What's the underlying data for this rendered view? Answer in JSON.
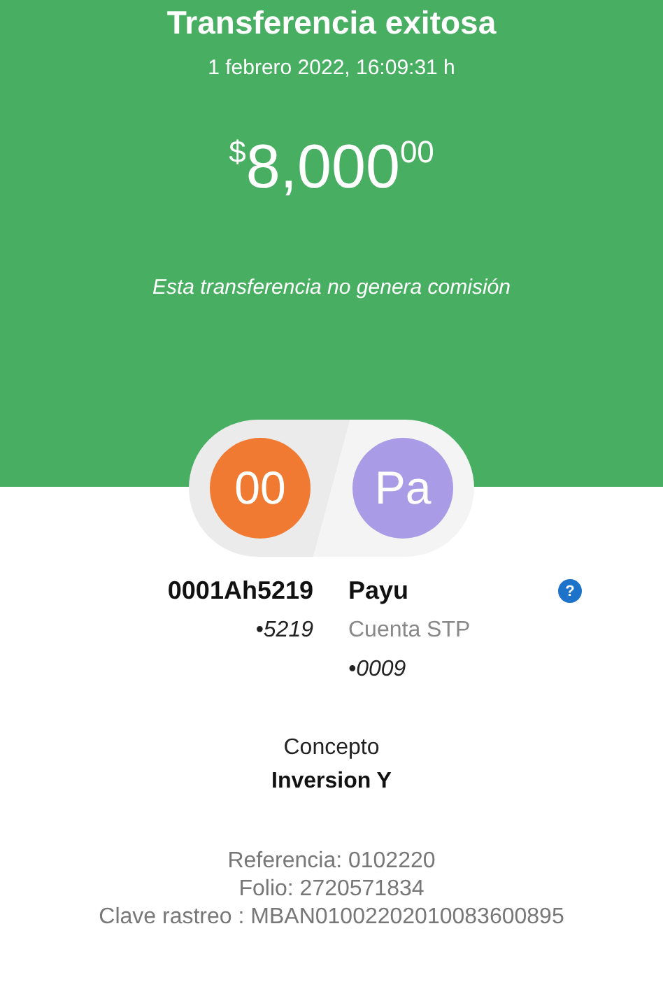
{
  "header": {
    "title": "Transferencia exitosa",
    "datetime": "1 febrero 2022, 16:09:31 h",
    "amount": {
      "currency": "$",
      "whole": "8,000",
      "cents": "00"
    },
    "note": "Esta transferencia no genera comisión"
  },
  "origin": {
    "initials": "00",
    "color": "#f07a31",
    "name": "0001Ah5219",
    "account": "•5219"
  },
  "destination": {
    "initials": "Pa",
    "color": "#a99be6",
    "name": "Payu",
    "bank": "Cuenta STP",
    "account": "•0009"
  },
  "help_icon": "?",
  "concept": {
    "label": "Concepto",
    "value": "Inversion Y"
  },
  "details": [
    "Referencia: 0102220",
    "Folio: 2720571834",
    "Clave rastreo : MBAN01002202010083600895"
  ]
}
